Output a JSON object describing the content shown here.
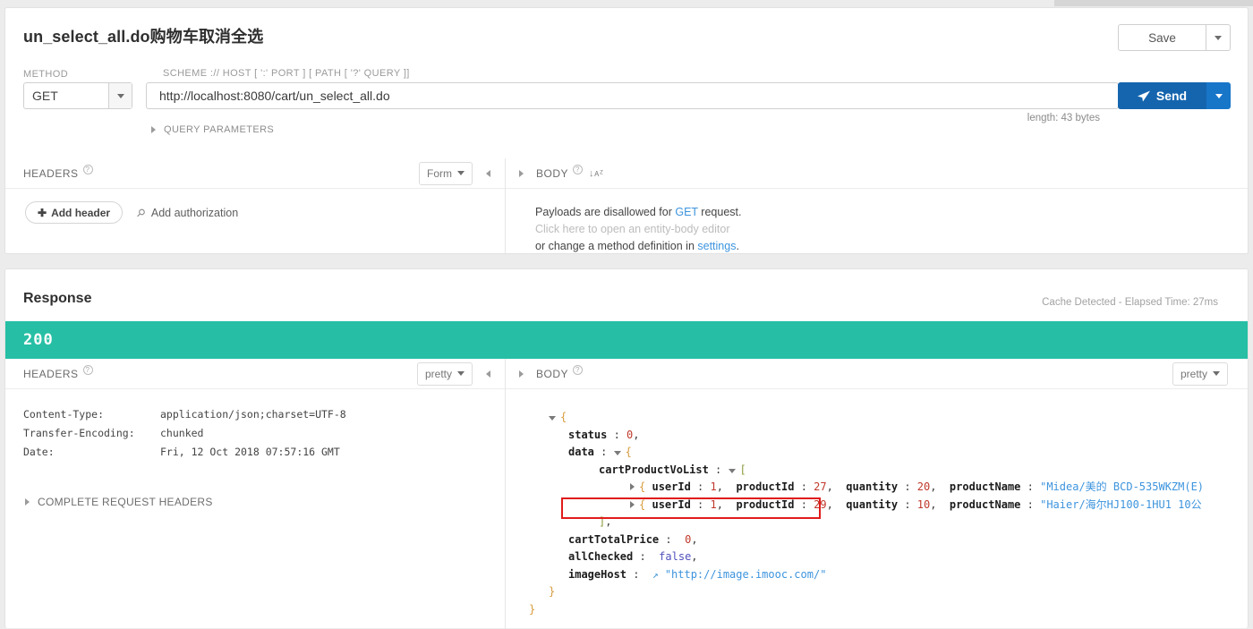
{
  "request": {
    "title": "un_select_all.do购物车取消全选",
    "save_label": "Save",
    "method_label": "METHOD",
    "method_value": "GET",
    "url_label": "SCHEME :// HOST [ ':' PORT ] [ PATH [ '?' QUERY ]]",
    "url_value": "http://localhost:8080/cart/un_select_all.do",
    "send_label": "Send",
    "length_note": "length: 43 bytes",
    "query_parameters_label": "QUERY PARAMETERS",
    "headers": {
      "title": "HEADERS",
      "view_mode": "Form",
      "add_header_label": "Add header",
      "add_authorization_label": "Add authorization"
    },
    "body": {
      "title": "BODY",
      "line1_pre": "Payloads are disallowed for ",
      "line1_link": "GET",
      "line1_post": " request.",
      "line2": "Click here to open an entity-body editor",
      "line3_pre": "or change a method definition in ",
      "line3_link": "settings",
      "line3_post": "."
    }
  },
  "response": {
    "title": "Response",
    "meta": "Cache Detected - Elapsed Time: 27ms",
    "status_code": "200",
    "status_color": "#26bfa5",
    "headers": {
      "title": "HEADERS",
      "view_mode": "pretty",
      "rows": [
        {
          "key": "Content-Type:",
          "value": "application/json;charset=UTF-8"
        },
        {
          "key": "Transfer-Encoding:",
          "value": "chunked"
        },
        {
          "key": "Date:",
          "value": "Fri, 12 Oct 2018 07:57:16 GMT"
        }
      ],
      "complete_request_headers_label": "COMPLETE REQUEST HEADERS"
    },
    "body": {
      "title": "BODY",
      "view_mode": "pretty"
    }
  },
  "json_body": {
    "status_key": "status",
    "status_value": "0",
    "data_key": "data",
    "cart_list_key": "cartProductVoList",
    "items": [
      {
        "userId_key": "userId",
        "userId": "1",
        "productId_key": "productId",
        "productId": "27",
        "quantity_key": "quantity",
        "quantity": "20",
        "productName_key": "productName",
        "productName": "\"Midea/美的 BCD-535WKZM(E)"
      },
      {
        "userId_key": "userId",
        "userId": "1",
        "productId_key": "productId",
        "productId": "29",
        "quantity_key": "quantity",
        "quantity": "10",
        "productName_key": "productName",
        "productName": "\"Haier/海尔HJ100-1HU1 10公"
      }
    ],
    "cart_total_price_key": "cartTotalPrice",
    "cart_total_price": "0",
    "all_checked_key": "allChecked",
    "all_checked": "false",
    "image_host_key": "imageHost",
    "image_host": "\"http://image.imooc.com/\""
  },
  "colors": {
    "accent_blue": "#1565ae",
    "status_green": "#26bfa5",
    "highlight_red": "#e11b1b",
    "link_blue": "#3d94dd"
  }
}
